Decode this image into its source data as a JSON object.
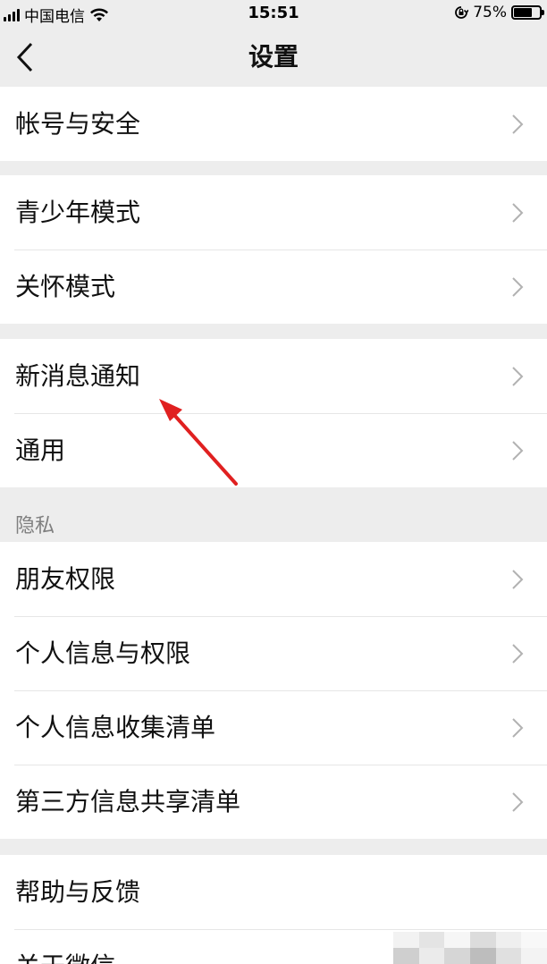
{
  "status_bar": {
    "carrier": "中国电信",
    "time": "15:51",
    "battery_percent": "75%",
    "battery_level": 0.75
  },
  "nav": {
    "title": "设置",
    "back_icon": "chevron-left-icon"
  },
  "groups": [
    {
      "items": [
        {
          "label": "帐号与安全"
        }
      ]
    },
    {
      "items": [
        {
          "label": "青少年模式"
        },
        {
          "label": "关怀模式"
        }
      ]
    },
    {
      "items": [
        {
          "label": "新消息通知"
        },
        {
          "label": "通用"
        }
      ]
    },
    {
      "section_label": "隐私",
      "items": [
        {
          "label": "朋友权限"
        },
        {
          "label": "个人信息与权限"
        },
        {
          "label": "个人信息收集清单"
        },
        {
          "label": "第三方信息共享清单"
        }
      ]
    },
    {
      "items": [
        {
          "label": "帮助与反馈"
        },
        {
          "label": "关于微信"
        }
      ]
    }
  ],
  "colors": {
    "background": "#ededed",
    "annotation_arrow": "#e02020",
    "chevron": "#b2b2b2"
  }
}
